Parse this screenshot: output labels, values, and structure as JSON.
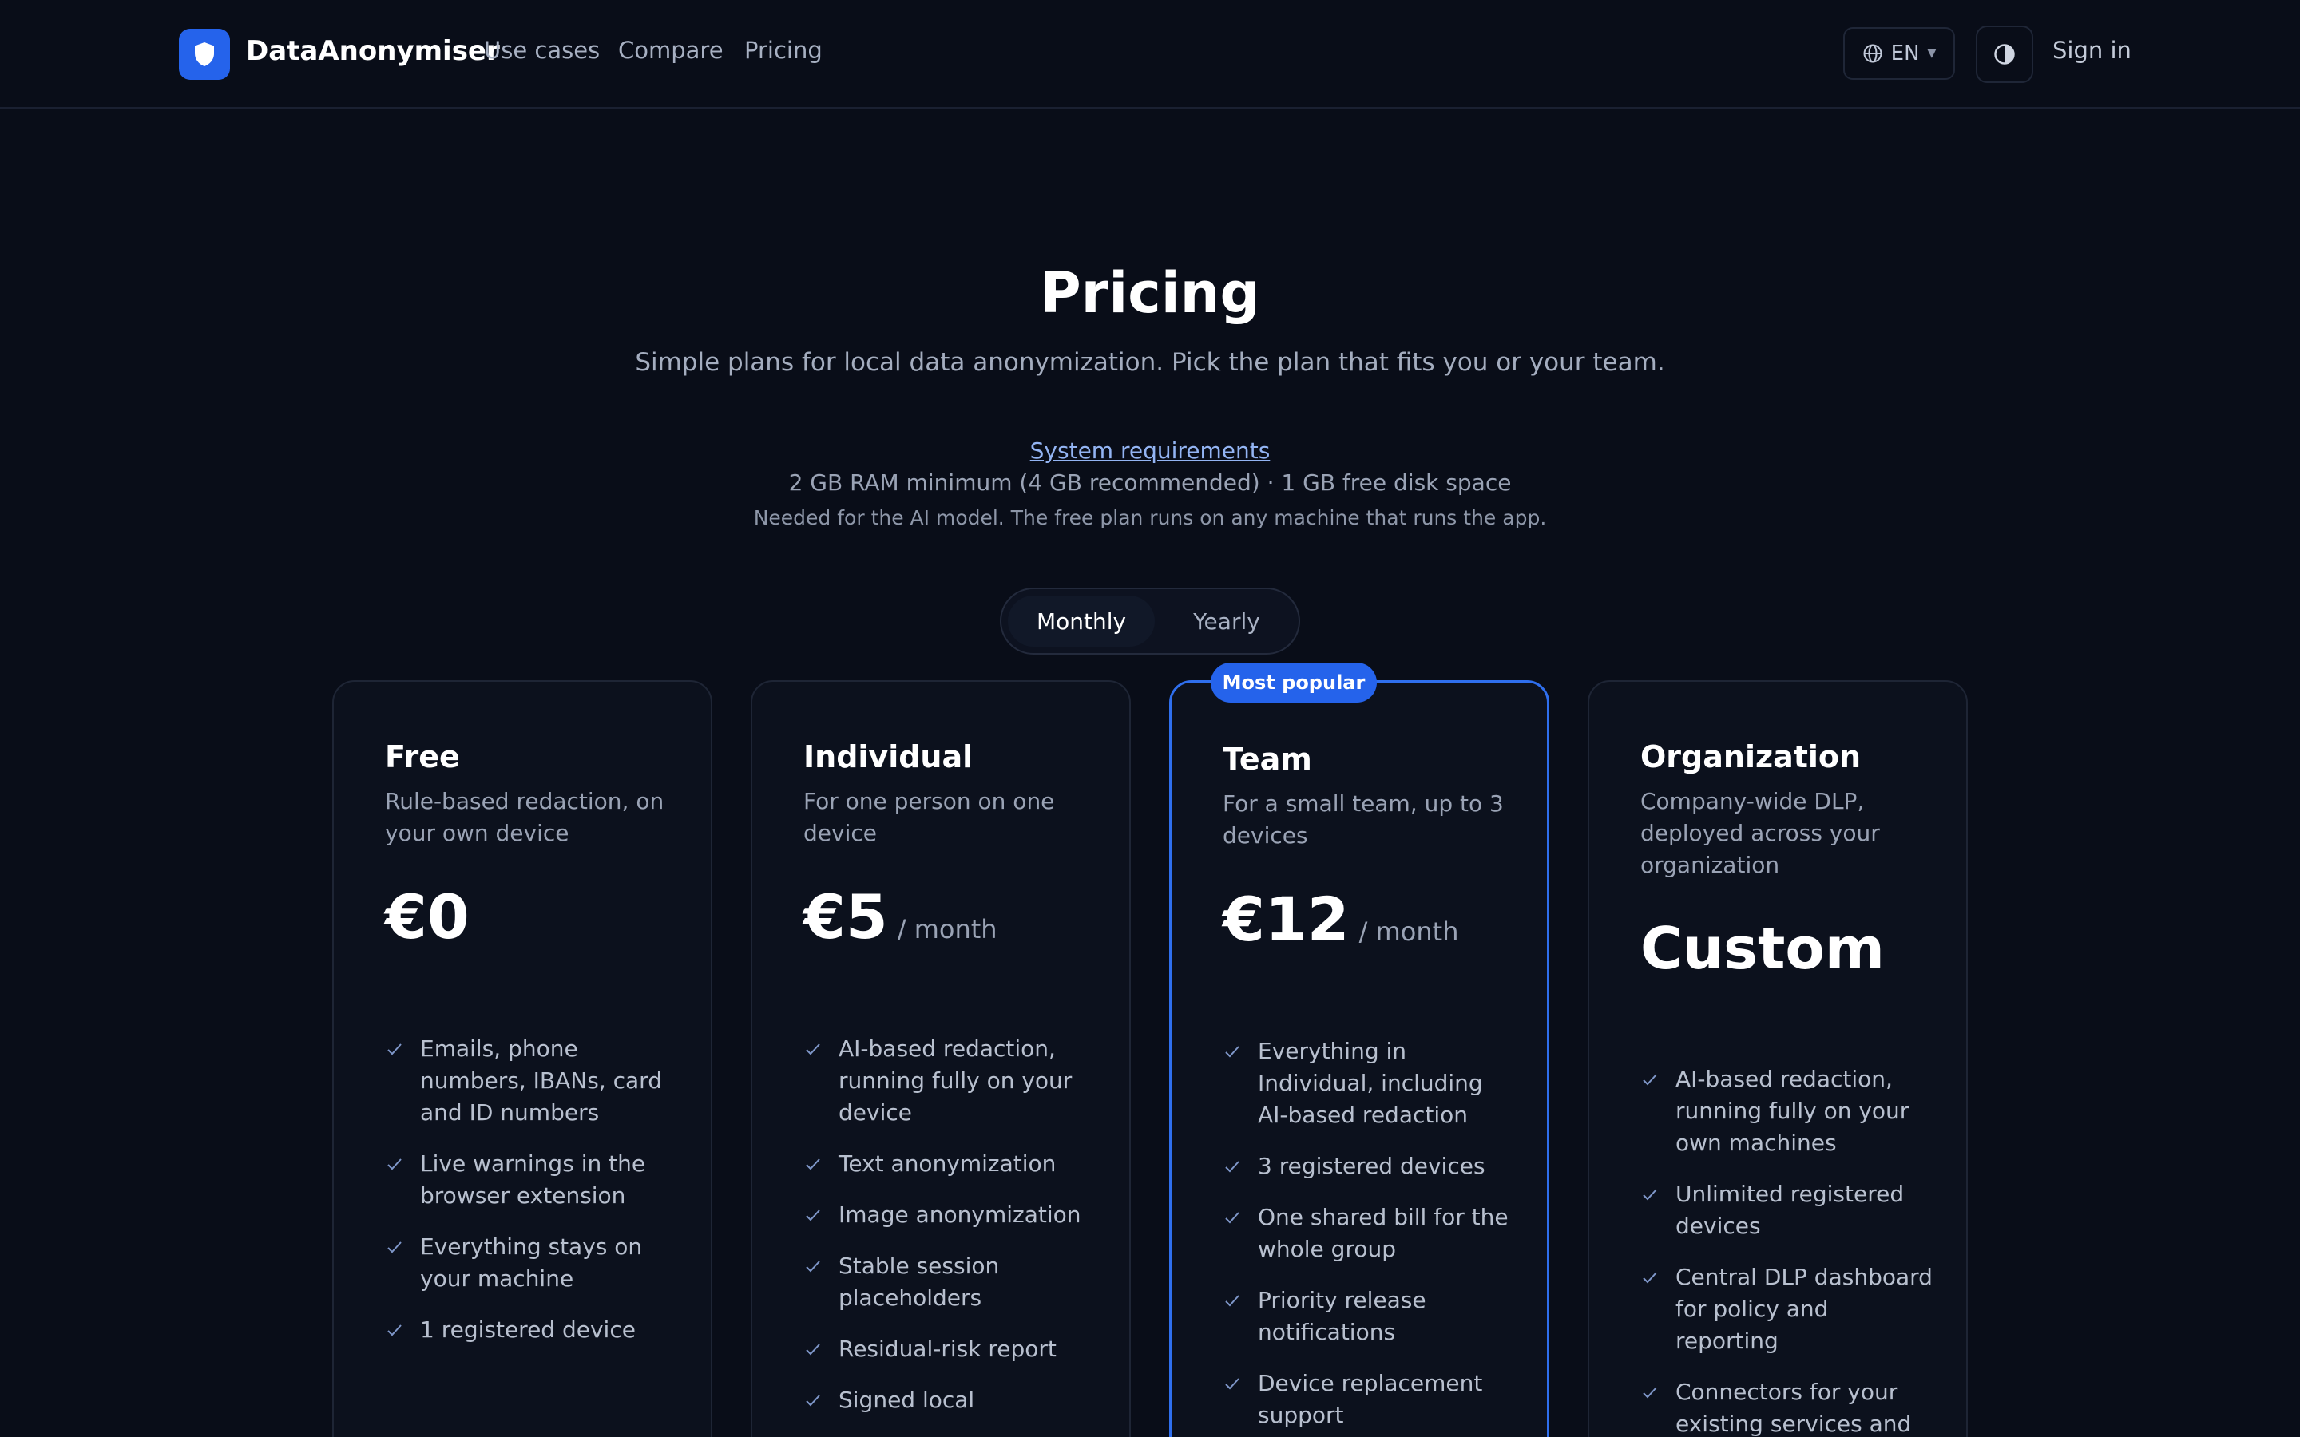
{
  "header": {
    "brand": "DataAnonymiser",
    "nav": [
      "Use cases",
      "Compare",
      "Pricing"
    ],
    "language": "EN",
    "sign_in": "Sign in"
  },
  "hero": {
    "title": "Pricing",
    "subtitle": "Simple plans for local data anonymization. Pick the plan that fits you or your team.",
    "requirements_link": "System requirements",
    "requirements_text": "2 GB RAM minimum (4 GB recommended) · 1 GB free disk space",
    "requirements_note": "Needed for the AI model. The free plan runs on any machine that runs the app."
  },
  "billing_toggle": {
    "options": [
      "Monthly",
      "Yearly"
    ],
    "selected": "Monthly"
  },
  "popular_badge": "Most popular",
  "plans": [
    {
      "name": "Free",
      "description": "Rule-based redaction, on your own device",
      "price": "€0",
      "period": "",
      "features": [
        "Emails, phone numbers, IBANs, card and ID numbers",
        "Live warnings in the browser extension",
        "Everything stays on your machine",
        "1 registered device"
      ]
    },
    {
      "name": "Individual",
      "description": "For one person on one device",
      "price": "€5",
      "period": "/ month",
      "features": [
        "AI-based redaction, running fully on your device",
        "Text anonymization",
        "Image anonymization",
        "Stable session placeholders",
        "Residual-risk report",
        "Signed local"
      ]
    },
    {
      "name": "Team",
      "description": "For a small team, up to 3 devices",
      "price": "€12",
      "period": "/ month",
      "features": [
        "Everything in Individual, including AI-based redaction",
        "3 registered devices",
        "One shared bill for the whole group",
        "Priority release notifications",
        "Device replacement support"
      ]
    },
    {
      "name": "Organization",
      "description": "Company-wide DLP, deployed across your organization",
      "price": "Custom",
      "period": "",
      "features": [
        "AI-based redaction, running fully on your own machines",
        "Unlimited registered devices",
        "Central DLP dashboard for policy and reporting",
        "Connectors for your existing services and"
      ]
    }
  ],
  "colors": {
    "background": "#090d18",
    "card": "#0c111d",
    "accent": "#2563eb",
    "popular_border": "#2f6fee"
  }
}
